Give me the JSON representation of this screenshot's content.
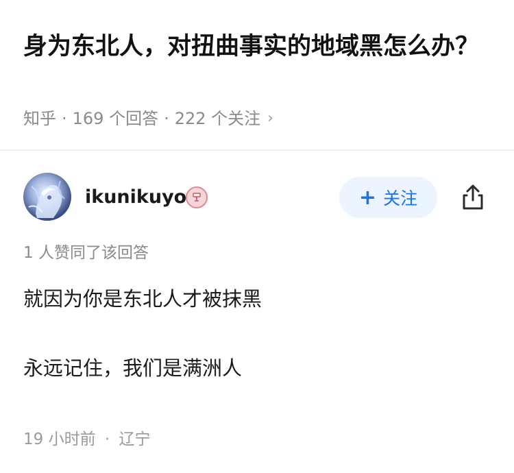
{
  "question": {
    "title": "身为东北人，对扭曲事实的地域黑怎么办？",
    "source": "知乎",
    "answers_count": "169 个回答",
    "followers_count": "222 个关注",
    "separator": "·",
    "chevron": "›"
  },
  "author": {
    "name": "ikunikuyo",
    "avatar_icon": "anime-avatar",
    "badge_icon": "badge-icon"
  },
  "actions": {
    "follow_plus": "+",
    "follow_label": "关注",
    "share_icon": "share-icon"
  },
  "answer": {
    "likes": "1 人赞同了该回答",
    "paragraphs": [
      "就因为你是东北人才被抹黑",
      "永远记住，我们是满洲人"
    ],
    "time": "19 小时前",
    "location": "辽宁"
  },
  "colors": {
    "accent": "#1772f6",
    "follow_bg": "#ebf4ff",
    "meta_gray": "#8a8a8a",
    "badge_red": "#e28a93"
  }
}
